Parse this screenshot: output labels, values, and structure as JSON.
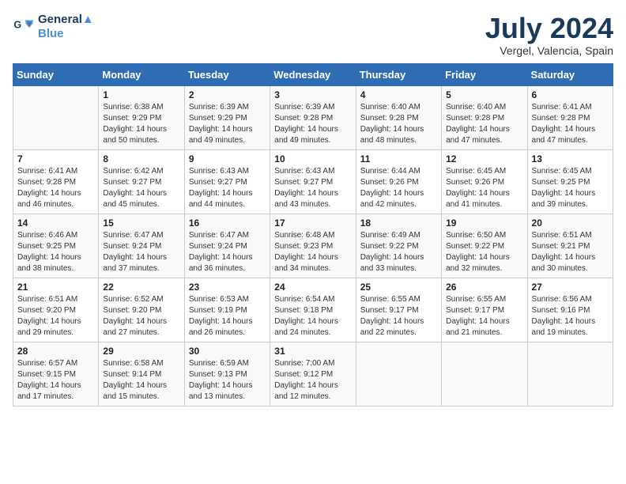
{
  "header": {
    "logo_line1": "General",
    "logo_line2": "Blue",
    "title": "July 2024",
    "location": "Vergel, Valencia, Spain"
  },
  "days_of_week": [
    "Sunday",
    "Monday",
    "Tuesday",
    "Wednesday",
    "Thursday",
    "Friday",
    "Saturday"
  ],
  "weeks": [
    [
      {
        "num": "",
        "content": ""
      },
      {
        "num": "1",
        "content": "Sunrise: 6:38 AM\nSunset: 9:29 PM\nDaylight: 14 hours\nand 50 minutes."
      },
      {
        "num": "2",
        "content": "Sunrise: 6:39 AM\nSunset: 9:29 PM\nDaylight: 14 hours\nand 49 minutes."
      },
      {
        "num": "3",
        "content": "Sunrise: 6:39 AM\nSunset: 9:28 PM\nDaylight: 14 hours\nand 49 minutes."
      },
      {
        "num": "4",
        "content": "Sunrise: 6:40 AM\nSunset: 9:28 PM\nDaylight: 14 hours\nand 48 minutes."
      },
      {
        "num": "5",
        "content": "Sunrise: 6:40 AM\nSunset: 9:28 PM\nDaylight: 14 hours\nand 47 minutes."
      },
      {
        "num": "6",
        "content": "Sunrise: 6:41 AM\nSunset: 9:28 PM\nDaylight: 14 hours\nand 47 minutes."
      }
    ],
    [
      {
        "num": "7",
        "content": "Sunrise: 6:41 AM\nSunset: 9:28 PM\nDaylight: 14 hours\nand 46 minutes."
      },
      {
        "num": "8",
        "content": "Sunrise: 6:42 AM\nSunset: 9:27 PM\nDaylight: 14 hours\nand 45 minutes."
      },
      {
        "num": "9",
        "content": "Sunrise: 6:43 AM\nSunset: 9:27 PM\nDaylight: 14 hours\nand 44 minutes."
      },
      {
        "num": "10",
        "content": "Sunrise: 6:43 AM\nSunset: 9:27 PM\nDaylight: 14 hours\nand 43 minutes."
      },
      {
        "num": "11",
        "content": "Sunrise: 6:44 AM\nSunset: 9:26 PM\nDaylight: 14 hours\nand 42 minutes."
      },
      {
        "num": "12",
        "content": "Sunrise: 6:45 AM\nSunset: 9:26 PM\nDaylight: 14 hours\nand 41 minutes."
      },
      {
        "num": "13",
        "content": "Sunrise: 6:45 AM\nSunset: 9:25 PM\nDaylight: 14 hours\nand 39 minutes."
      }
    ],
    [
      {
        "num": "14",
        "content": "Sunrise: 6:46 AM\nSunset: 9:25 PM\nDaylight: 14 hours\nand 38 minutes."
      },
      {
        "num": "15",
        "content": "Sunrise: 6:47 AM\nSunset: 9:24 PM\nDaylight: 14 hours\nand 37 minutes."
      },
      {
        "num": "16",
        "content": "Sunrise: 6:47 AM\nSunset: 9:24 PM\nDaylight: 14 hours\nand 36 minutes."
      },
      {
        "num": "17",
        "content": "Sunrise: 6:48 AM\nSunset: 9:23 PM\nDaylight: 14 hours\nand 34 minutes."
      },
      {
        "num": "18",
        "content": "Sunrise: 6:49 AM\nSunset: 9:22 PM\nDaylight: 14 hours\nand 33 minutes."
      },
      {
        "num": "19",
        "content": "Sunrise: 6:50 AM\nSunset: 9:22 PM\nDaylight: 14 hours\nand 32 minutes."
      },
      {
        "num": "20",
        "content": "Sunrise: 6:51 AM\nSunset: 9:21 PM\nDaylight: 14 hours\nand 30 minutes."
      }
    ],
    [
      {
        "num": "21",
        "content": "Sunrise: 6:51 AM\nSunset: 9:20 PM\nDaylight: 14 hours\nand 29 minutes."
      },
      {
        "num": "22",
        "content": "Sunrise: 6:52 AM\nSunset: 9:20 PM\nDaylight: 14 hours\nand 27 minutes."
      },
      {
        "num": "23",
        "content": "Sunrise: 6:53 AM\nSunset: 9:19 PM\nDaylight: 14 hours\nand 26 minutes."
      },
      {
        "num": "24",
        "content": "Sunrise: 6:54 AM\nSunset: 9:18 PM\nDaylight: 14 hours\nand 24 minutes."
      },
      {
        "num": "25",
        "content": "Sunrise: 6:55 AM\nSunset: 9:17 PM\nDaylight: 14 hours\nand 22 minutes."
      },
      {
        "num": "26",
        "content": "Sunrise: 6:55 AM\nSunset: 9:17 PM\nDaylight: 14 hours\nand 21 minutes."
      },
      {
        "num": "27",
        "content": "Sunrise: 6:56 AM\nSunset: 9:16 PM\nDaylight: 14 hours\nand 19 minutes."
      }
    ],
    [
      {
        "num": "28",
        "content": "Sunrise: 6:57 AM\nSunset: 9:15 PM\nDaylight: 14 hours\nand 17 minutes."
      },
      {
        "num": "29",
        "content": "Sunrise: 6:58 AM\nSunset: 9:14 PM\nDaylight: 14 hours\nand 15 minutes."
      },
      {
        "num": "30",
        "content": "Sunrise: 6:59 AM\nSunset: 9:13 PM\nDaylight: 14 hours\nand 13 minutes."
      },
      {
        "num": "31",
        "content": "Sunrise: 7:00 AM\nSunset: 9:12 PM\nDaylight: 14 hours\nand 12 minutes."
      },
      {
        "num": "",
        "content": ""
      },
      {
        "num": "",
        "content": ""
      },
      {
        "num": "",
        "content": ""
      }
    ]
  ]
}
